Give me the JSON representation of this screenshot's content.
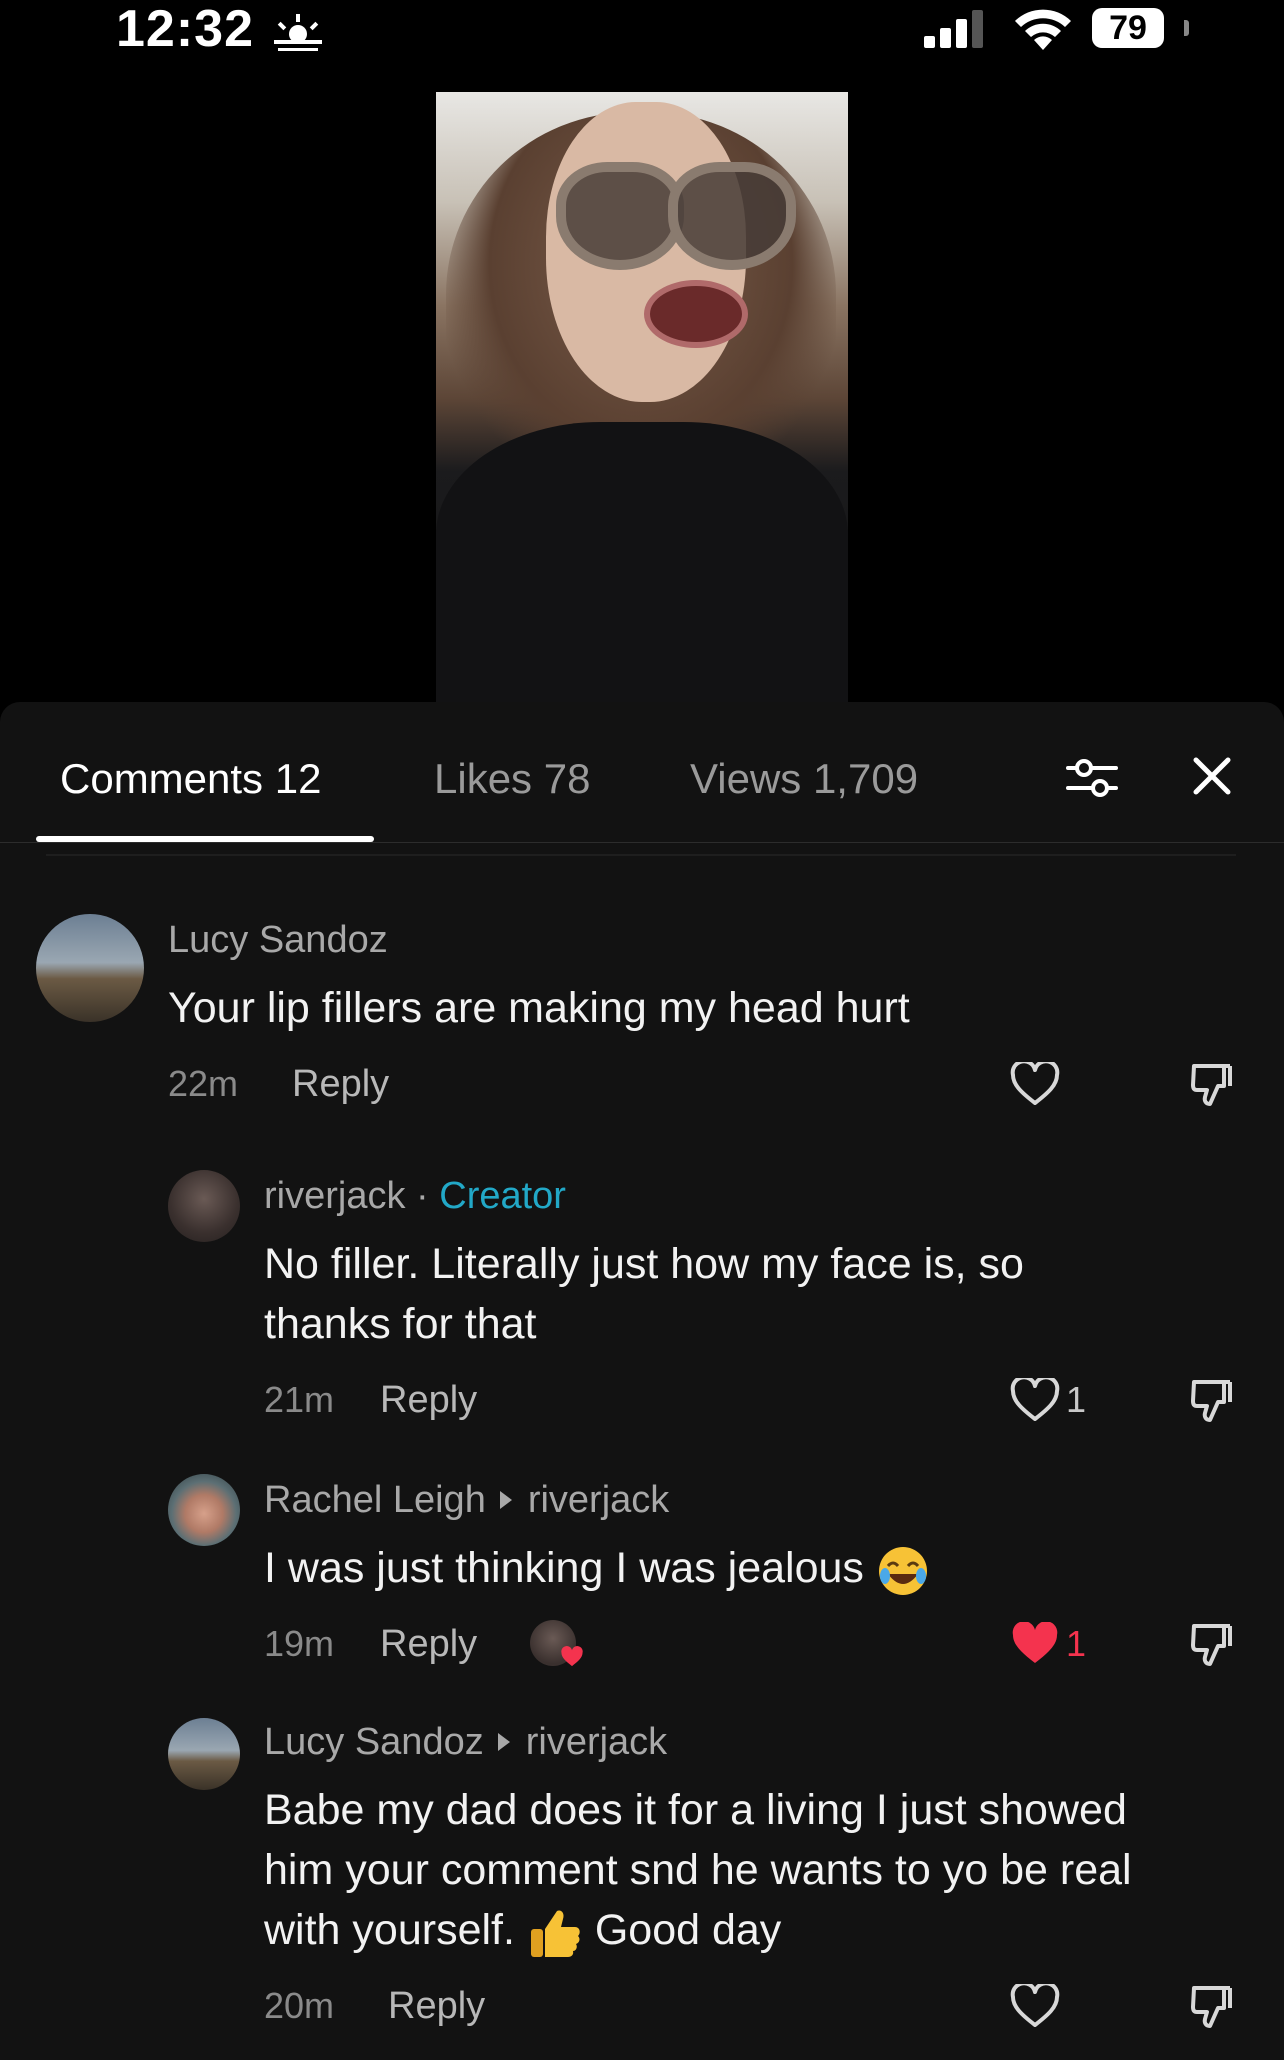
{
  "status": {
    "time": "12:32",
    "battery": "79"
  },
  "tabs": [
    {
      "label": "Comments 12"
    },
    {
      "label": "Likes 78"
    },
    {
      "label": "Views 1,709"
    }
  ],
  "comments": [
    {
      "author": "Lucy Sandoz",
      "text": "Your lip fillers are making my head hurt",
      "time": "22m",
      "reply": "Reply"
    },
    {
      "author": "riverjack",
      "badge": "Creator",
      "text1": "No filler. Literally just how my face is, so",
      "text2": "thanks for that",
      "time": "21m",
      "reply": "Reply",
      "likes": "1"
    },
    {
      "author": "Rachel Leigh",
      "reply_to": "riverjack",
      "text": "I was just thinking I was jealous",
      "time": "19m",
      "reply": "Reply",
      "likes": "1"
    },
    {
      "author": "Lucy Sandoz",
      "reply_to": "riverjack",
      "text1": "Babe my dad does it for a living I just showed",
      "text2": "him your comment snd he wants to yo be real",
      "text3a": "with yourself.",
      "text3b": "Good day",
      "time": "20m",
      "reply": "Reply"
    }
  ],
  "colors": {
    "creator": "#22a8c7",
    "liked": "#f4334e",
    "sheet": "#121212"
  }
}
